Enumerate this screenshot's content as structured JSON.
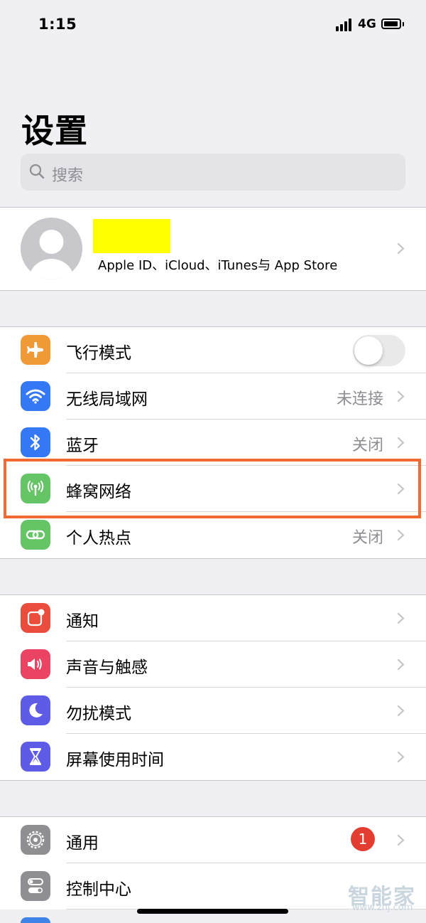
{
  "status_bar": {
    "time": "1:15",
    "network": "4G"
  },
  "page_title": "设置",
  "search": {
    "placeholder": "搜索"
  },
  "profile": {
    "subtitle": "Apple ID、iCloud、iTunes与 App Store"
  },
  "group1": [
    {
      "label": "飞行模式",
      "icon": "airplane-icon",
      "color": "#f09a37",
      "toggle": false
    },
    {
      "label": "无线局域网",
      "icon": "wifi-icon",
      "color": "#3478f6",
      "value": "未连接"
    },
    {
      "label": "蓝牙",
      "icon": "bluetooth-icon",
      "color": "#3478f6",
      "value": "关闭"
    },
    {
      "label": "蜂窝网络",
      "icon": "cellular-icon",
      "color": "#65c466",
      "value": ""
    },
    {
      "label": "个人热点",
      "icon": "hotspot-icon",
      "color": "#65c466",
      "value": "关闭"
    }
  ],
  "group2": [
    {
      "label": "通知",
      "icon": "notification-icon",
      "color": "#eb4d3d"
    },
    {
      "label": "声音与触感",
      "icon": "sound-icon",
      "color": "#eb4462"
    },
    {
      "label": "勿扰模式",
      "icon": "moon-icon",
      "color": "#5e5ce6"
    },
    {
      "label": "屏幕使用时间",
      "icon": "hourglass-icon",
      "color": "#5e5ce6"
    }
  ],
  "group3": [
    {
      "label": "通用",
      "icon": "gear-icon",
      "color": "#8e8e93",
      "badge": "1"
    },
    {
      "label": "控制中心",
      "icon": "toggles-icon",
      "color": "#8e8e93"
    }
  ],
  "watermark": {
    "brand": "智能家",
    "url": "www.znj.com"
  }
}
